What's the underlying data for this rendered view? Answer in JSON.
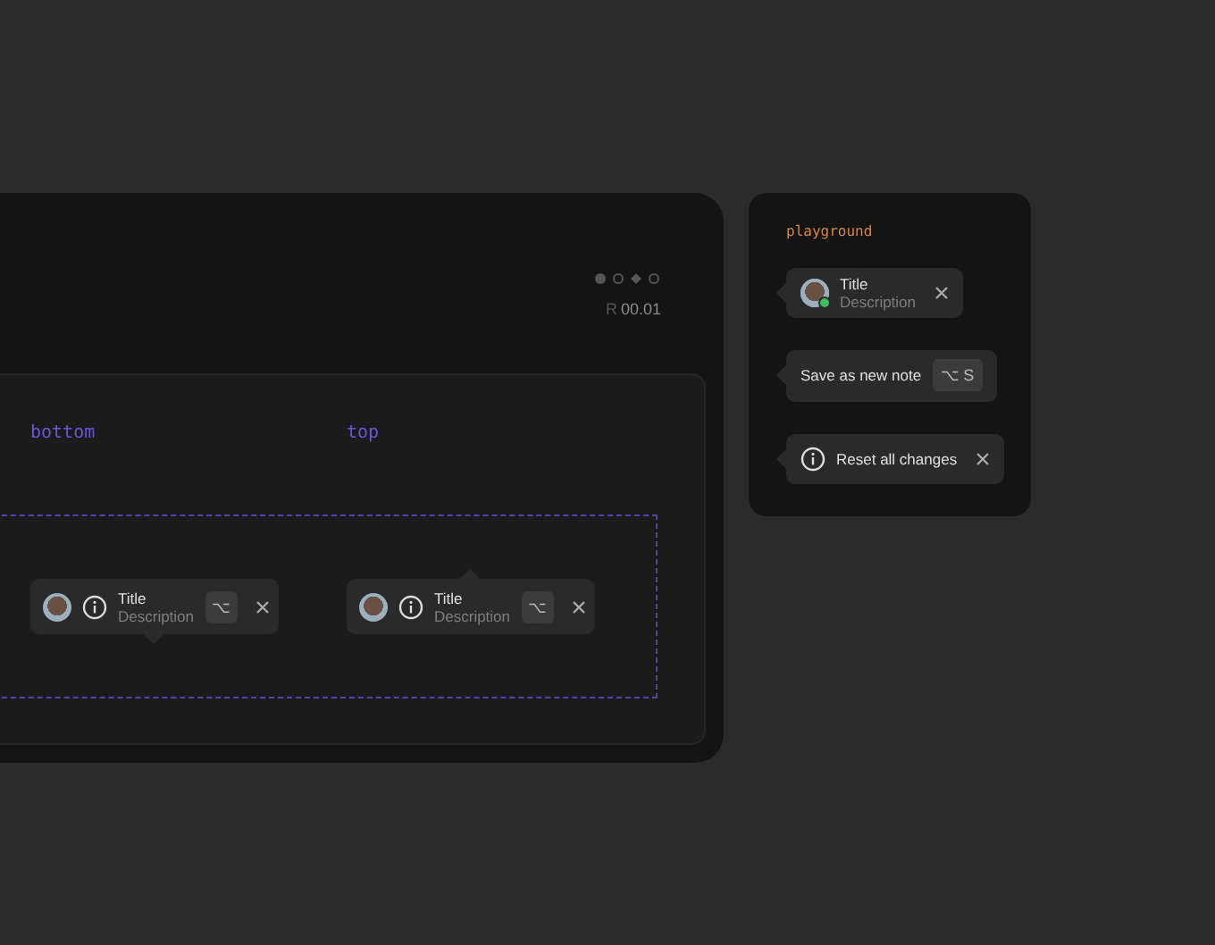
{
  "demo": {
    "reading_prefix": "R",
    "reading": "00.01",
    "placements": [
      {
        "label": "bottom",
        "pointer_below": true,
        "title": "Title",
        "description": "Description",
        "shortcut": "⌥"
      },
      {
        "label": "top",
        "pointer_below": false,
        "title": "Title",
        "description": "Description",
        "shortcut": "⌥"
      }
    ]
  },
  "playground": {
    "title": "playground",
    "tooltips": [
      {
        "kind": "profile",
        "title": "Title",
        "description": "Description",
        "online": true
      },
      {
        "kind": "shortcut",
        "text": "Save as new note",
        "shortcut": "⌥ S"
      },
      {
        "kind": "info",
        "text": "Reset all changes"
      }
    ]
  }
}
